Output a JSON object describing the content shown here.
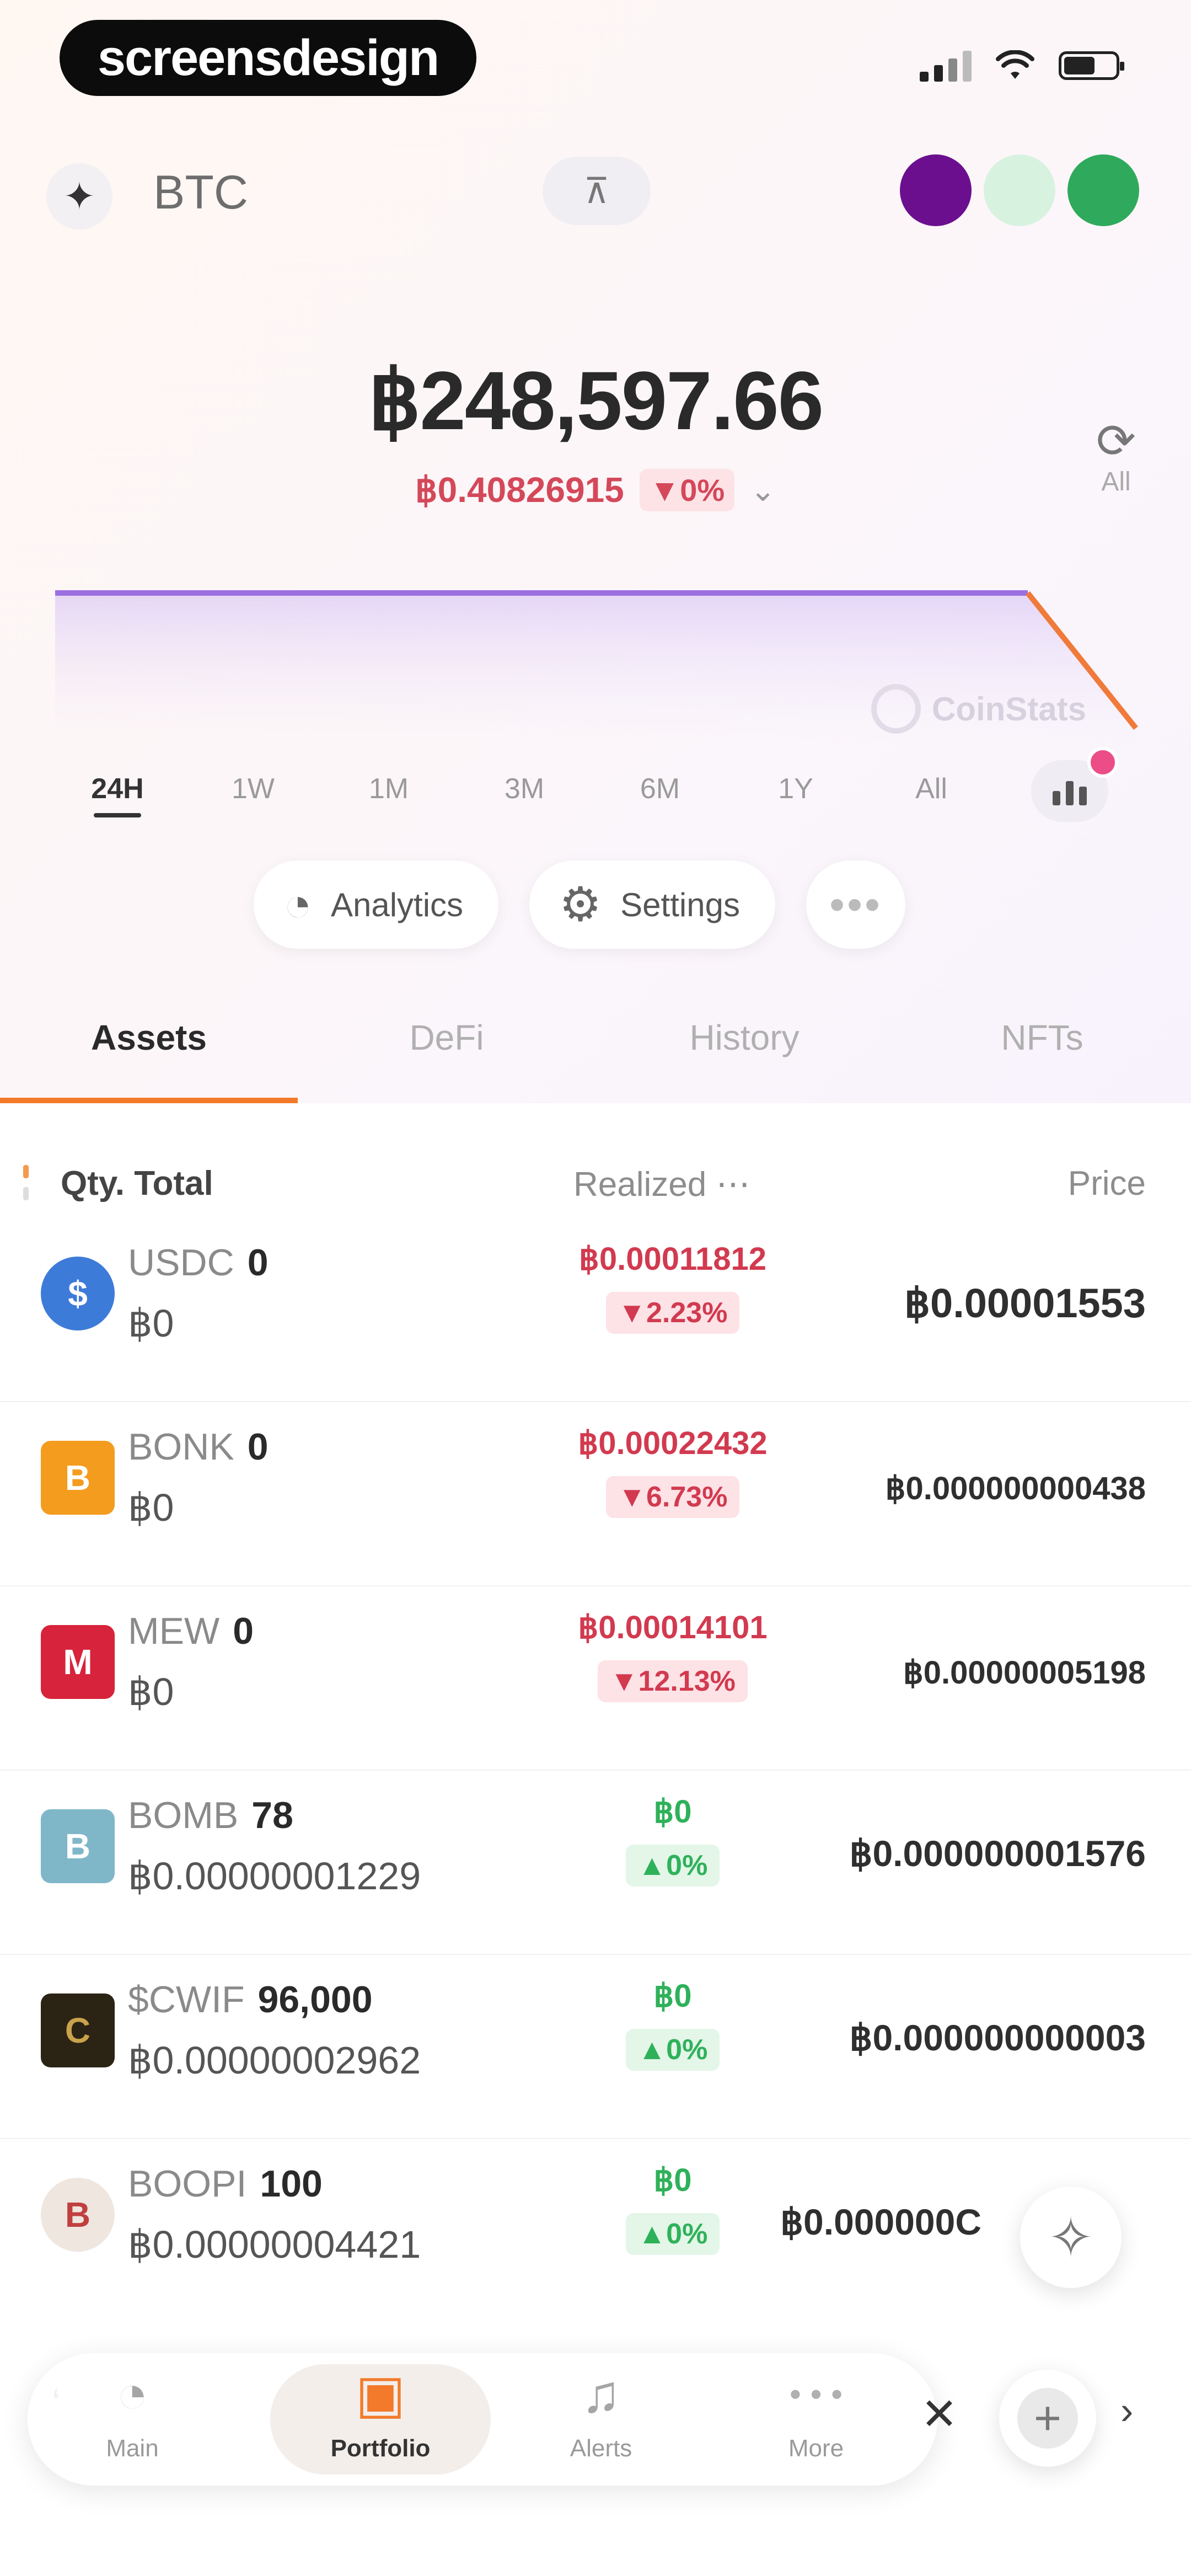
{
  "status_bar": {
    "brand": "screensdesign"
  },
  "header": {
    "title": "BTC",
    "avatars": [
      "A1",
      "A2",
      "A3"
    ]
  },
  "balance": {
    "amount": "฿248,597.66",
    "change_value": "฿0.40826915",
    "change_pct": "▼0%",
    "refresh_label": "All"
  },
  "chart": {
    "watermark": "CoinStats",
    "ranges": [
      "24H",
      "1W",
      "1M",
      "3M",
      "6M",
      "1Y",
      "All"
    ],
    "active_range": "24H"
  },
  "chart_data": {
    "type": "area",
    "x": [
      0,
      1,
      2,
      3,
      4,
      5,
      6,
      7,
      8,
      9,
      10
    ],
    "values": [
      248600,
      248600,
      248600,
      248600,
      248600,
      248600,
      248600,
      248600,
      248600,
      248600,
      248597.66
    ]
  },
  "actions": {
    "analytics": "Analytics",
    "settings": "Settings",
    "more": "•••"
  },
  "tabs": [
    "Assets",
    "DeFi",
    "History",
    "NFTs"
  ],
  "active_tab": "Assets",
  "table": {
    "headers": {
      "qty": "Qty. Total",
      "realized": "Realized ⋯",
      "price": "Price"
    },
    "rows": [
      {
        "symbol": "USDC",
        "qty": "0",
        "total": "฿0",
        "realized": "฿0.00011812",
        "change": "▼2.23%",
        "price": "฿0.00001553",
        "dir": "neg",
        "icon_color": "#3d7bd9",
        "icon_glyph": "$"
      },
      {
        "symbol": "BONK",
        "qty": "0",
        "total": "฿0",
        "realized": "฿0.00022432",
        "change": "▼6.73%",
        "price": "฿0.000000000438",
        "dir": "neg",
        "icon_color": "#f39c1e",
        "icon_glyph": "B"
      },
      {
        "symbol": "MEW",
        "qty": "0",
        "total": "฿0",
        "realized": "฿0.00014101",
        "change": "▼12.13%",
        "price": "฿0.00000005198",
        "dir": "neg",
        "icon_color": "#d7233b",
        "icon_glyph": "M"
      },
      {
        "symbol": "BOMB",
        "qty": "78",
        "total": "฿0.00000001229",
        "realized": "฿0",
        "change": "▲0%",
        "price": "฿0.000000001576",
        "dir": "pos",
        "icon_color": "#7fb7c9",
        "icon_glyph": "B"
      },
      {
        "symbol": "$CWIF",
        "qty": "96,000",
        "total": "฿0.00000002962",
        "realized": "฿0",
        "change": "▲0%",
        "price": "฿0.000000000003",
        "dir": "pos",
        "icon_color": "#2b2415",
        "icon_glyph": "C"
      },
      {
        "symbol": "BOOPI",
        "qty": "100",
        "total": "฿0.00000004421",
        "realized": "฿0",
        "change": "▲0%",
        "price": "฿0.000000C",
        "dir": "pos",
        "icon_color": "#efe6e0",
        "icon_glyph": "B"
      }
    ]
  },
  "bottom_nav": {
    "items": [
      {
        "label": "Main",
        "icon": "pie-chart-icon"
      },
      {
        "label": "Portfolio",
        "icon": "briefcase-icon"
      },
      {
        "label": "Alerts",
        "icon": "bell-icon"
      },
      {
        "label": "More",
        "icon": "more-icon"
      }
    ],
    "active": "Portfolio"
  },
  "colors": {
    "accent": "#f27a2a",
    "negative": "#d23a4f",
    "positive": "#2fb15a",
    "chart_line": "#9b6fe0"
  }
}
